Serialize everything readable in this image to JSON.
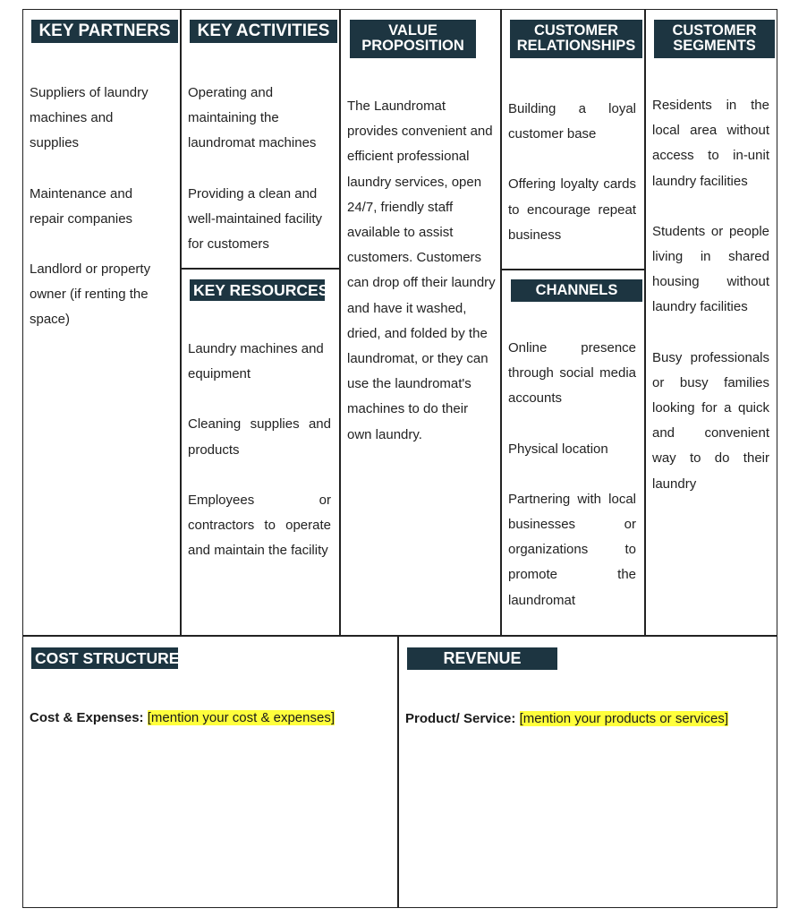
{
  "canvas": {
    "key_partners": {
      "title": "KEY PARTNERS",
      "items": [
        "Suppliers of laundry machines and supplies",
        "Maintenance and repair companies",
        "Landlord or property owner (if renting the space)"
      ]
    },
    "key_activities": {
      "title": "KEY ACTIVITIES",
      "items": [
        "Operating and maintaining the laundromat machines",
        "Providing a clean and well-maintained facility for customers"
      ]
    },
    "key_resources": {
      "title": "KEY RESOURCES",
      "items": [
        "Laundry machines and equipment",
        "Cleaning supplies and products",
        "Employees or contractors to operate and maintain the facility"
      ]
    },
    "value_proposition": {
      "title_line1": "VALUE",
      "title_line2": "PROPOSITION",
      "text": "The Laundromat provides convenient and efficient professional laundry services, open 24/7, friendly staff available to assist customers. Customers can drop off their laundry and have it washed, dried, and folded by the laundromat, or they can use the laundromat's machines to do their own laundry."
    },
    "customer_relationships": {
      "title_line1": "CUSTOMER",
      "title_line2": "RELATIONSHIPS",
      "items": [
        "Building a loyal customer base",
        "Offering loyalty cards to encourage repeat business"
      ]
    },
    "channels": {
      "title": "CHANNELS",
      "items": [
        "Online presence through social media accounts",
        "Physical location",
        "Partnering with local businesses or organizations to promote the laundromat"
      ]
    },
    "customer_segments": {
      "title_line1": "CUSTOMER",
      "title_line2": "SEGMENTS",
      "items": [
        "Residents in the local area without access to in-unit laundry facilities",
        "Students or people living in shared housing without laundry facilities",
        "Busy professionals or busy families looking for a quick and convenient way to do their laundry"
      ]
    },
    "cost_structure": {
      "title": "COST STRUCTURE",
      "label": "Cost & Expenses:",
      "placeholder": "[mention your cost & expenses]"
    },
    "revenue": {
      "title": "REVENUE",
      "label": "Product/ Service:",
      "placeholder": "[mention your products or services]"
    }
  },
  "colors": {
    "header_bg": "#1d3541",
    "header_text": "#ffffff",
    "highlight": "#ffff3c",
    "border": "#222222"
  }
}
